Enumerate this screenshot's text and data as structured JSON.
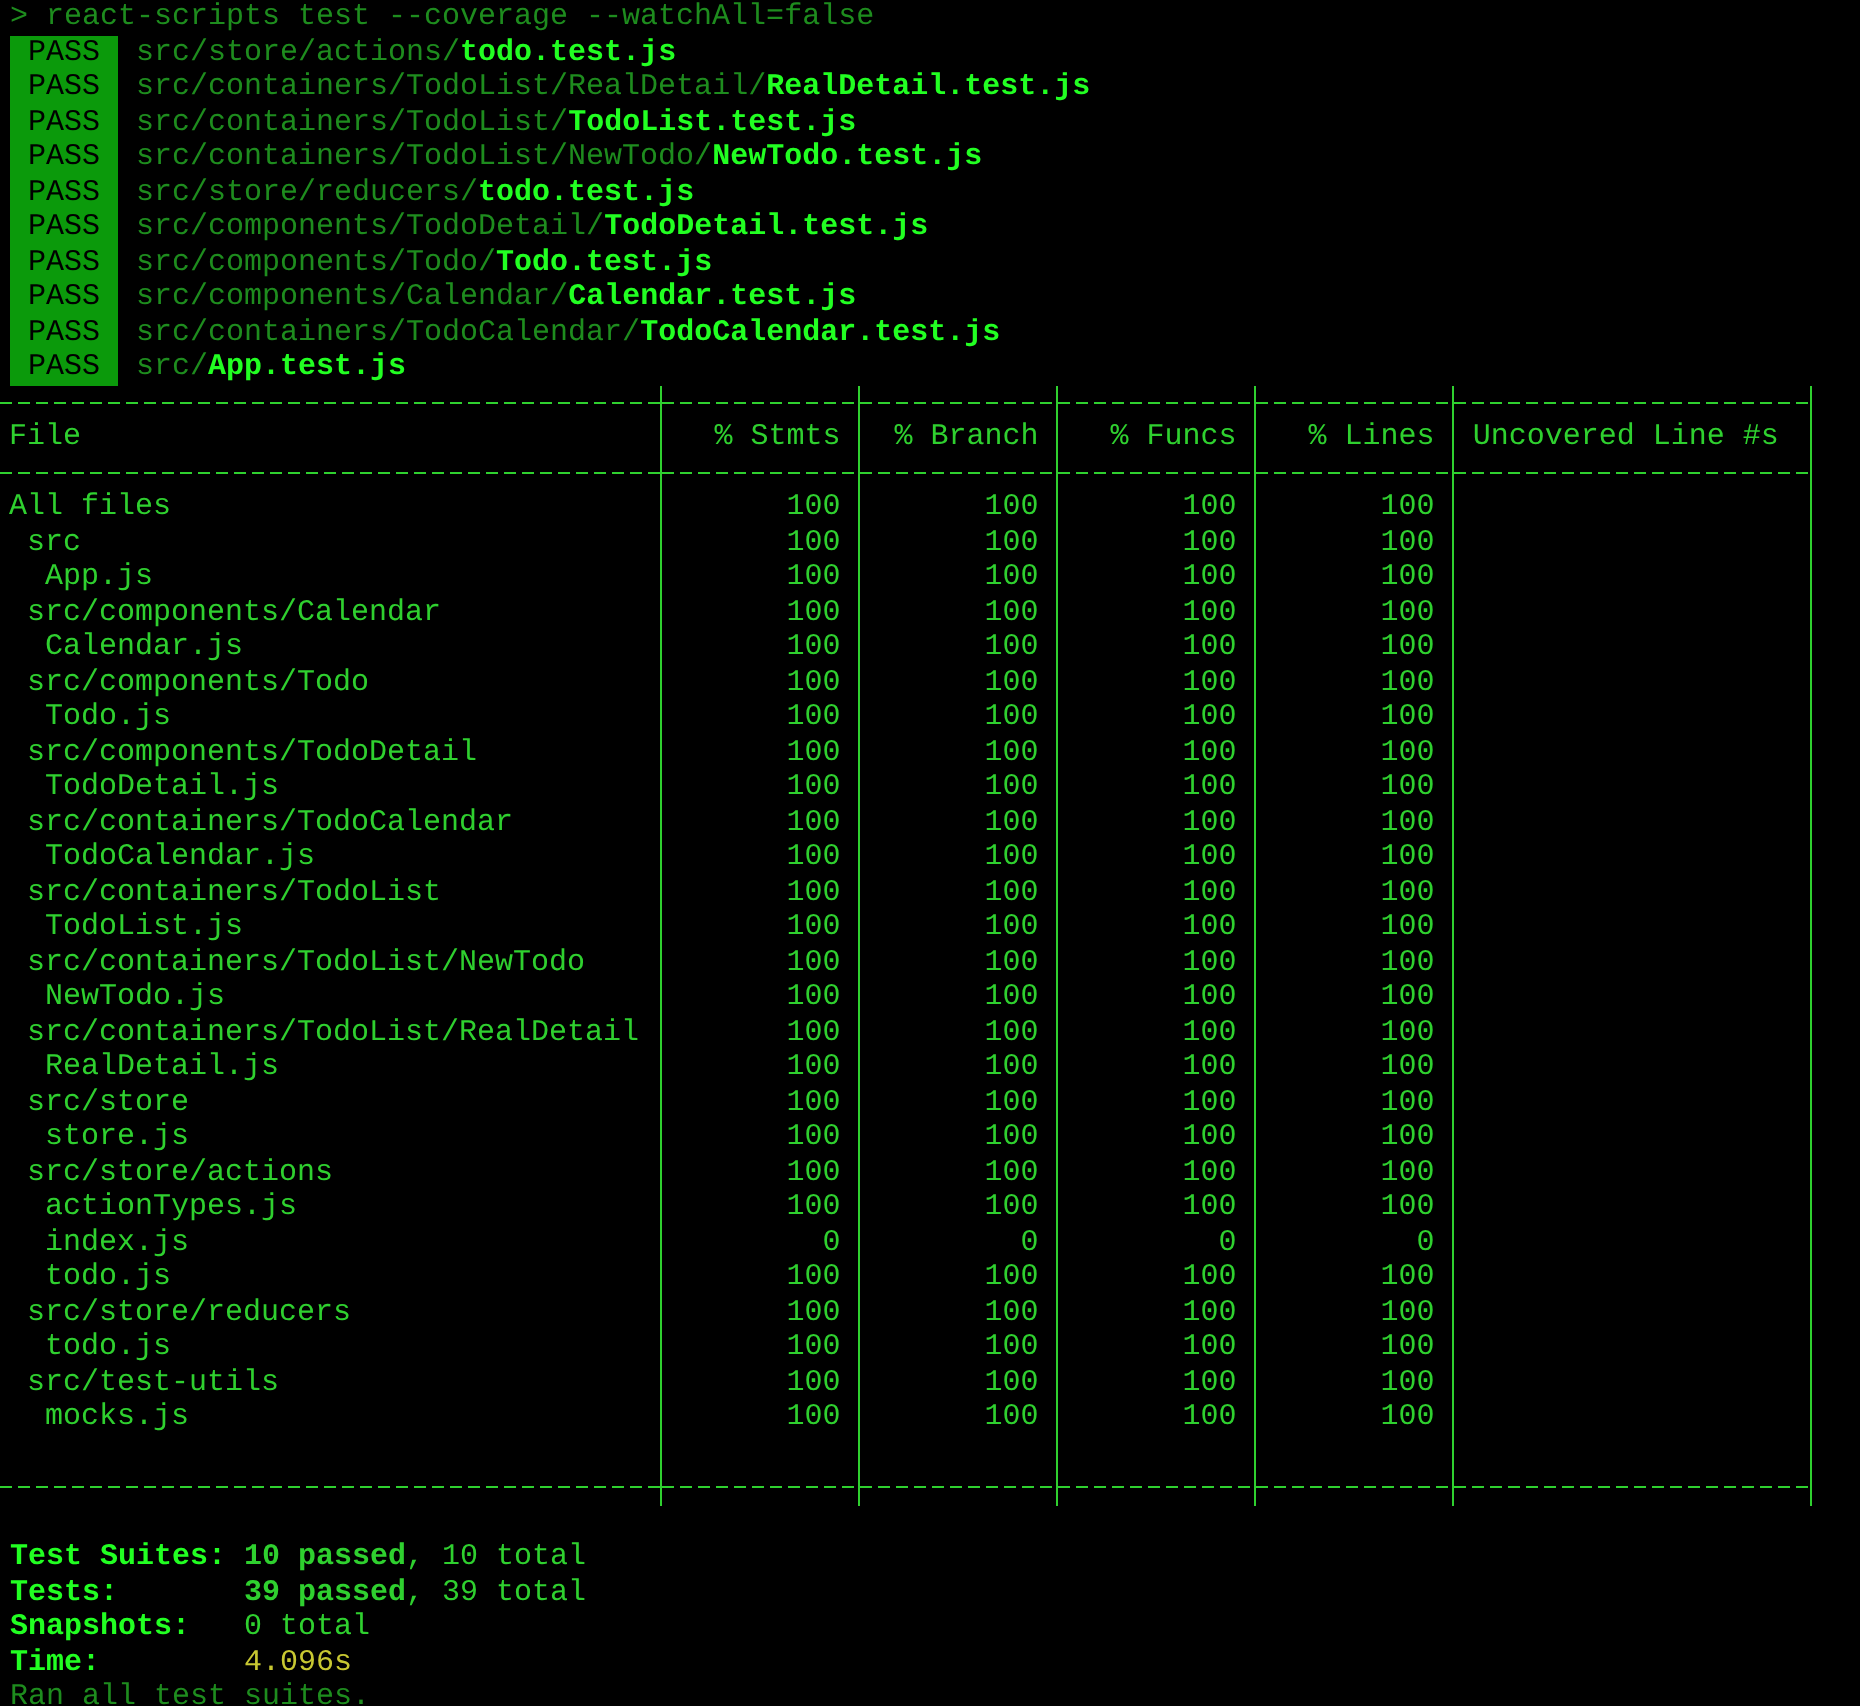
{
  "command_line": "> react-scripts test --coverage --watchAll=false",
  "test_results": [
    {
      "status": "PASS",
      "directory": "src/store/actions/",
      "file": "todo.test.js"
    },
    {
      "status": "PASS",
      "directory": "src/containers/TodoList/RealDetail/",
      "file": "RealDetail.test.js"
    },
    {
      "status": "PASS",
      "directory": "src/containers/TodoList/",
      "file": "TodoList.test.js"
    },
    {
      "status": "PASS",
      "directory": "src/containers/TodoList/NewTodo/",
      "file": "NewTodo.test.js"
    },
    {
      "status": "PASS",
      "directory": "src/store/reducers/",
      "file": "todo.test.js"
    },
    {
      "status": "PASS",
      "directory": "src/components/TodoDetail/",
      "file": "TodoDetail.test.js"
    },
    {
      "status": "PASS",
      "directory": "src/components/Todo/",
      "file": "Todo.test.js"
    },
    {
      "status": "PASS",
      "directory": "src/components/Calendar/",
      "file": "Calendar.test.js"
    },
    {
      "status": "PASS",
      "directory": "src/containers/TodoCalendar/",
      "file": "TodoCalendar.test.js"
    },
    {
      "status": "PASS",
      "directory": "src/",
      "file": "App.test.js"
    }
  ],
  "coverage_table": {
    "columns": [
      "File",
      "% Stmts",
      "% Branch",
      "% Funcs",
      "% Lines",
      "Uncovered Line #s"
    ],
    "rows": [
      {
        "file": "All files",
        "values": [
          "100",
          "100",
          "100",
          "100"
        ],
        "children": [
          {
            "file": "src",
            "values": [
              "100",
              "100",
              "100",
              "100"
            ],
            "children": [
              {
                "file": "App.js",
                "values": [
                  "100",
                  "100",
                  "100",
                  "100"
                ]
              }
            ]
          },
          {
            "file": "src/components/Calendar",
            "values": [
              "100",
              "100",
              "100",
              "100"
            ],
            "children": [
              {
                "file": "Calendar.js",
                "values": [
                  "100",
                  "100",
                  "100",
                  "100"
                ]
              }
            ]
          },
          {
            "file": "src/components/Todo",
            "values": [
              "100",
              "100",
              "100",
              "100"
            ],
            "children": [
              {
                "file": "Todo.js",
                "values": [
                  "100",
                  "100",
                  "100",
                  "100"
                ]
              }
            ]
          },
          {
            "file": "src/components/TodoDetail",
            "values": [
              "100",
              "100",
              "100",
              "100"
            ],
            "children": [
              {
                "file": "TodoDetail.js",
                "values": [
                  "100",
                  "100",
                  "100",
                  "100"
                ]
              }
            ]
          },
          {
            "file": "src/containers/TodoCalendar",
            "values": [
              "100",
              "100",
              "100",
              "100"
            ],
            "children": [
              {
                "file": "TodoCalendar.js",
                "values": [
                  "100",
                  "100",
                  "100",
                  "100"
                ]
              }
            ]
          },
          {
            "file": "src/containers/TodoList",
            "values": [
              "100",
              "100",
              "100",
              "100"
            ],
            "children": [
              {
                "file": "TodoList.js",
                "values": [
                  "100",
                  "100",
                  "100",
                  "100"
                ]
              }
            ]
          },
          {
            "file": "src/containers/TodoList/NewTodo",
            "values": [
              "100",
              "100",
              "100",
              "100"
            ],
            "children": [
              {
                "file": "NewTodo.js",
                "values": [
                  "100",
                  "100",
                  "100",
                  "100"
                ]
              }
            ]
          },
          {
            "file": "src/containers/TodoList/RealDetail",
            "values": [
              "100",
              "100",
              "100",
              "100"
            ],
            "children": [
              {
                "file": "RealDetail.js",
                "values": [
                  "100",
                  "100",
                  "100",
                  "100"
                ]
              }
            ]
          },
          {
            "file": "src/store",
            "values": [
              "100",
              "100",
              "100",
              "100"
            ],
            "children": [
              {
                "file": "store.js",
                "values": [
                  "100",
                  "100",
                  "100",
                  "100"
                ]
              }
            ]
          },
          {
            "file": "src/store/actions",
            "values": [
              "100",
              "100",
              "100",
              "100"
            ],
            "children": [
              {
                "file": "actionTypes.js",
                "values": [
                  "100",
                  "100",
                  "100",
                  "100"
                ]
              },
              {
                "file": "index.js",
                "values": [
                  "0",
                  "0",
                  "0",
                  "0"
                ]
              },
              {
                "file": "todo.js",
                "values": [
                  "100",
                  "100",
                  "100",
                  "100"
                ]
              }
            ]
          },
          {
            "file": "src/store/reducers",
            "values": [
              "100",
              "100",
              "100",
              "100"
            ],
            "children": [
              {
                "file": "todo.js",
                "values": [
                  "100",
                  "100",
                  "100",
                  "100"
                ]
              }
            ]
          },
          {
            "file": "src/test-utils",
            "values": [
              "100",
              "100",
              "100",
              "100"
            ],
            "children": [
              {
                "file": "mocks.js",
                "values": [
                  "100",
                  "100",
                  "100",
                  "100"
                ]
              }
            ]
          }
        ]
      }
    ]
  },
  "summary": [
    {
      "label": "Test Suites:",
      "value": "**10 passed**, 10 total",
      "kind": "count"
    },
    {
      "label": "Tests:",
      "value": "**39 passed**, 39 total",
      "kind": "count"
    },
    {
      "label": "Snapshots:",
      "value": "0 total",
      "kind": "count"
    },
    {
      "label": "Time:",
      "value": "4.096s",
      "kind": "time"
    }
  ],
  "footer": "Ran all test suites."
}
